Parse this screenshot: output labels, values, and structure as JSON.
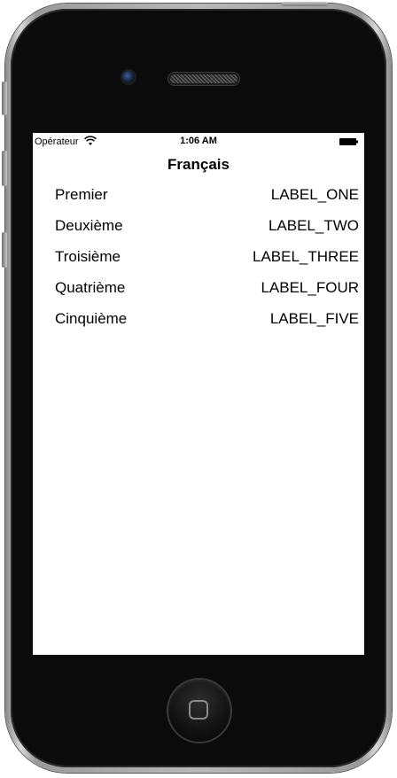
{
  "status_bar": {
    "carrier": "Opérateur",
    "time": "1:06 AM",
    "wifi_icon": "wifi-icon",
    "battery_icon": "battery-icon"
  },
  "nav": {
    "title": "Français"
  },
  "rows": [
    {
      "left": "Premier",
      "right": "LABEL_ONE"
    },
    {
      "left": "Deuxième",
      "right": "LABEL_TWO"
    },
    {
      "left": "Troisième",
      "right": "LABEL_THREE"
    },
    {
      "left": "Quatrième",
      "right": "LABEL_FOUR"
    },
    {
      "left": "Cinquième",
      "right": "LABEL_FIVE"
    }
  ],
  "device": {
    "frame_color": "#b9b9b9",
    "bezel_color": "#0b0b0b",
    "screen_color": "#ffffff",
    "home_button_icon": "home-button-icon"
  }
}
